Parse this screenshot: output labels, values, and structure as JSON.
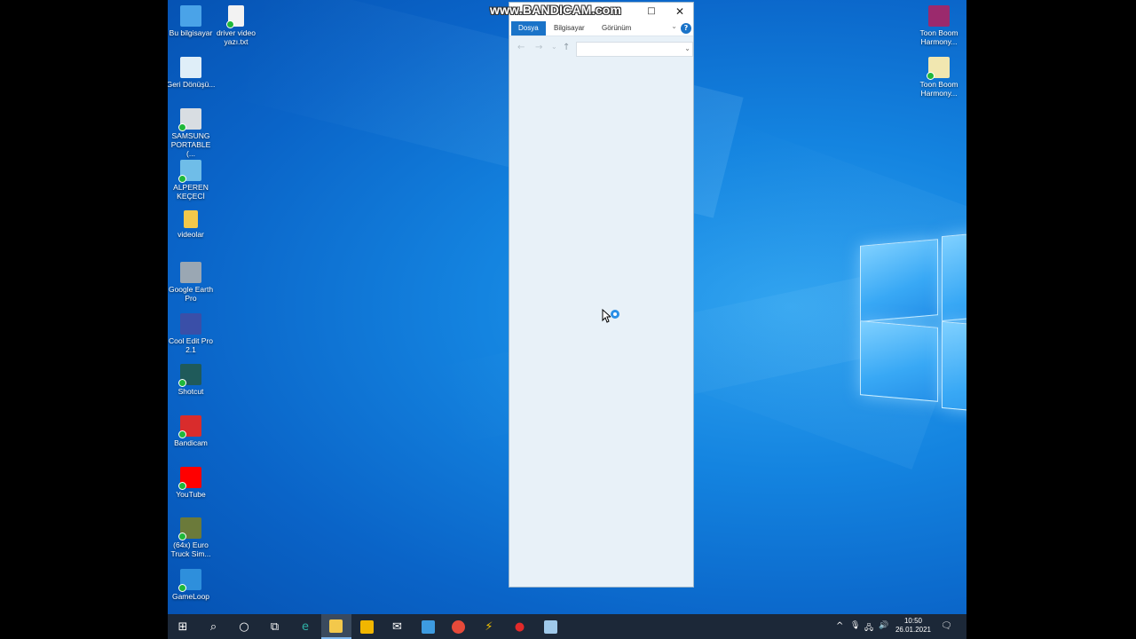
{
  "desktop": {
    "icons_left": [
      {
        "label": "Bu bilgisayar",
        "icon": "computer-icon",
        "color": "#4aa3e8"
      },
      {
        "label": "Geri Dönüşü...",
        "icon": "recycle-bin-icon",
        "color": "#dfeef8"
      },
      {
        "label": "SAMSUNG PORTABLE (...",
        "icon": "drive-icon",
        "color": "#d8dde2"
      },
      {
        "label": "ALPEREN KEÇECİ",
        "icon": "network-computer-icon",
        "color": "#6fbde8"
      },
      {
        "label": "videolar",
        "icon": "folder-icon",
        "color": "#f3c84b"
      },
      {
        "label": "Google Earth Pro",
        "icon": "google-earth-icon",
        "color": "#9aa7b3"
      },
      {
        "label": "Cool Edit Pro 2.1",
        "icon": "cool-edit-icon",
        "color": "#3a4fa8"
      },
      {
        "label": "Shotcut",
        "icon": "shotcut-icon",
        "color": "#1f5a5a"
      },
      {
        "label": "Bandicam",
        "icon": "bandicam-icon",
        "color": "#d92c2c"
      },
      {
        "label": "YouTube",
        "icon": "youtube-icon",
        "color": "#ff0000"
      },
      {
        "label": "(64x) Euro Truck Sim...",
        "icon": "euro-truck-icon",
        "color": "#6b7a3a"
      },
      {
        "label": "GameLoop",
        "icon": "gameloop-icon",
        "color": "#2e8fdc"
      }
    ],
    "icon_file": {
      "label": "driver video yazı.txt",
      "icon": "text-file-icon",
      "color": "#f2f2f2"
    },
    "icons_right": [
      {
        "label": "Toon Boom Harmony...",
        "icon": "toon-boom-installer-icon",
        "color": "#9b2a6d"
      },
      {
        "label": "Toon Boom Harmony...",
        "icon": "toon-boom-file-icon",
        "color": "#f1e7b0"
      }
    ]
  },
  "watermark": "www.BANDICAM.com",
  "explorer": {
    "tabs": [
      {
        "label": "Dosya",
        "active": true
      },
      {
        "label": "Bilgisayar",
        "active": false
      },
      {
        "label": "Görünüm",
        "active": false
      }
    ],
    "help": "?",
    "nav_back": "←",
    "nav_forward": "→",
    "nav_recent": "⌄",
    "nav_up": "↑",
    "address_value": "",
    "minimize": "□",
    "close": "✕"
  },
  "taskbar": {
    "apps": [
      {
        "name": "start-icon",
        "glyph": "⊞",
        "color": "#ffffff"
      },
      {
        "name": "search-icon",
        "glyph": "⌕",
        "color": "#ffffff"
      },
      {
        "name": "cortana-icon",
        "glyph": "○",
        "color": "#ffffff"
      },
      {
        "name": "task-view-icon",
        "glyph": "⧉",
        "color": "#ffffff"
      },
      {
        "name": "edge-icon",
        "glyph": "e",
        "color": "#2fb0a6"
      },
      {
        "name": "file-explorer-icon",
        "glyph": "",
        "color": "#f3c84b"
      },
      {
        "name": "store-icon",
        "glyph": "",
        "color": "#f1b600"
      },
      {
        "name": "mail-icon",
        "glyph": "✉",
        "color": "#ffffff"
      },
      {
        "name": "photos-icon",
        "glyph": "",
        "color": "#3d9be0"
      },
      {
        "name": "chrome-icon",
        "glyph": "",
        "color": "#e64a3a"
      },
      {
        "name": "winrar-icon",
        "glyph": "⚡",
        "color": "#f0c000"
      },
      {
        "name": "bandicam-record-icon",
        "glyph": "●",
        "color": "#e22a2a"
      },
      {
        "name": "notes-icon",
        "glyph": "",
        "color": "#9fc9ea"
      }
    ],
    "tray": {
      "chevron": "^",
      "mic": "🎙",
      "network": "🖧",
      "volume": "🔊",
      "time": "10:50",
      "date": "26.01.2021",
      "notification": "🗨"
    }
  }
}
